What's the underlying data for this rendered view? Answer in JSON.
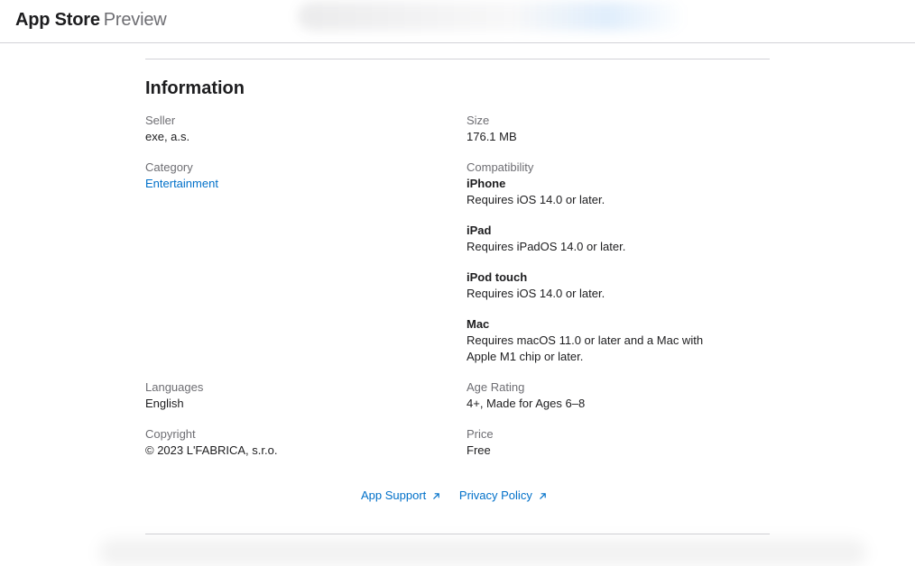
{
  "header": {
    "brand_name": "App Store",
    "brand_sub": "Preview"
  },
  "section": {
    "title": "Information"
  },
  "left_column": {
    "seller": {
      "label": "Seller",
      "value": "exe, a.s."
    },
    "category": {
      "label": "Category",
      "value": "Entertainment"
    },
    "languages": {
      "label": "Languages",
      "value": "English"
    },
    "copyright": {
      "label": "Copyright",
      "value": "© 2023 L'FABRICA, s.r.o."
    }
  },
  "right_column": {
    "size": {
      "label": "Size",
      "value": "176.1 MB"
    },
    "compatibility": {
      "label": "Compatibility",
      "devices": [
        {
          "name": "iPhone",
          "requirement": "Requires iOS 14.0 or later."
        },
        {
          "name": "iPad",
          "requirement": "Requires iPadOS 14.0 or later."
        },
        {
          "name": "iPod touch",
          "requirement": "Requires iOS 14.0 or later."
        },
        {
          "name": "Mac",
          "requirement": "Requires macOS 11.0 or later and a Mac with Apple M1 chip or later."
        }
      ]
    },
    "age_rating": {
      "label": "Age Rating",
      "value": "4+, Made for Ages 6–8"
    },
    "price": {
      "label": "Price",
      "value": "Free"
    }
  },
  "footer_links": {
    "app_support": "App Support",
    "privacy_policy": "Privacy Policy"
  },
  "colors": {
    "link": "#0070c9",
    "label": "#6e6e73",
    "text": "#1d1d1f",
    "divider": "#d2d2d7"
  },
  "icons": {
    "external_link": "arrow-up-right-icon"
  }
}
